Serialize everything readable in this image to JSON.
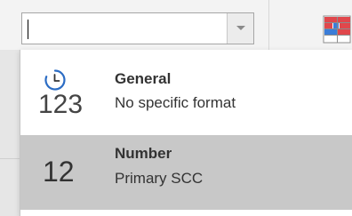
{
  "format_box": {
    "value": "",
    "dropdown_arrow_icon": "chevron-down-icon"
  },
  "ribbon": {
    "conditional_formatting_icon": "conditional-formatting-icon",
    "accent_red": "#e0474c",
    "accent_blue": "#3b7dd8"
  },
  "formats": [
    {
      "icon": "clock-icon",
      "sample": "123",
      "title": "General",
      "description": "No specific format",
      "selected": false
    },
    {
      "icon": "",
      "sample": "12",
      "title": "Number",
      "description": "Primary SCC",
      "selected": true
    }
  ],
  "colors": {
    "selected_row": "#c8c8c8",
    "clock_blue": "#2b6cc4"
  }
}
